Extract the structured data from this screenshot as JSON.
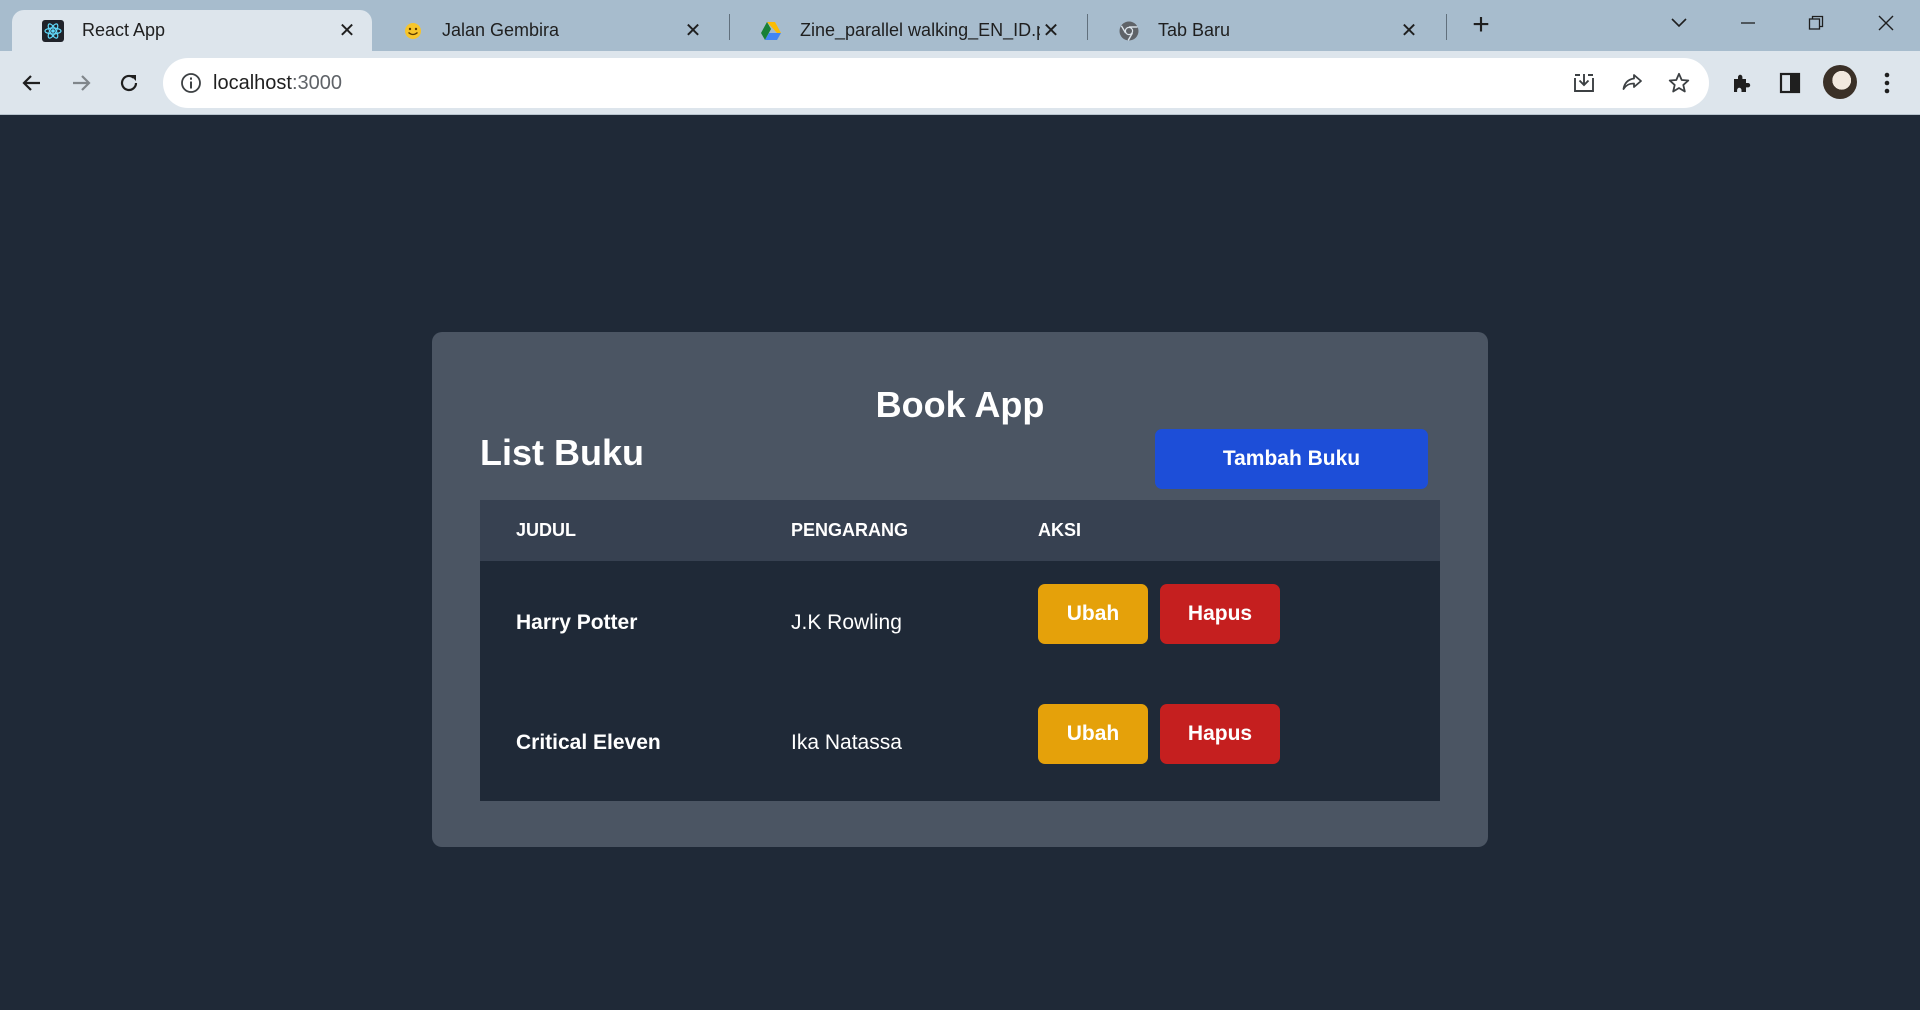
{
  "browser": {
    "tabs": [
      {
        "title": "React App",
        "icon": "react-icon",
        "active": true
      },
      {
        "title": "Jalan Gembira",
        "icon": "emoji-icon",
        "active": false
      },
      {
        "title": "Zine_parallel walking_EN_ID.pdf",
        "icon": "google-drive-icon",
        "active": false
      },
      {
        "title": "Tab Baru",
        "icon": "chrome-icon",
        "active": false
      }
    ],
    "url_host": "localhost",
    "url_port": ":3000"
  },
  "app": {
    "title": "Book App",
    "list_title": "List Buku",
    "add_button": "Tambah Buku",
    "columns": [
      "JUDUL",
      "PENGARANG",
      "AKSI"
    ],
    "books": [
      {
        "title": "Harry Potter",
        "author": "J.K Rowling",
        "edit": "Ubah",
        "delete": "Hapus"
      },
      {
        "title": "Critical Eleven",
        "author": "Ika Natassa",
        "edit": "Ubah",
        "delete": "Hapus"
      }
    ]
  },
  "colors": {
    "page_bg": "#1f2937",
    "card_bg": "#4b5563",
    "header_bg": "#374151",
    "primary": "#1d4ed8",
    "warning": "#e5a10a",
    "danger": "#c51f1f"
  }
}
